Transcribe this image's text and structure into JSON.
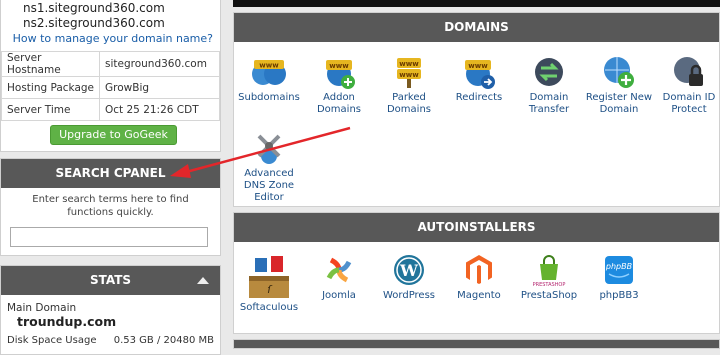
{
  "left": {
    "ns1": "ns1.siteground360.com",
    "ns2": "ns2.siteground360.com",
    "how_link": "How to manage your domain name?",
    "info_rows": [
      {
        "label": "Server Hostname",
        "value": "siteground360.com"
      },
      {
        "label": "Hosting Package",
        "value": "GrowBig"
      },
      {
        "label": "Server Time",
        "value": "Oct 25 21:26 CDT"
      }
    ],
    "upgrade_label": "Upgrade to GoGeek",
    "search": {
      "title": "SEARCH CPANEL",
      "help": "Enter search terms here to find functions quickly.",
      "placeholder": ""
    },
    "stats": {
      "title": "STATS",
      "main_domain_label": "Main Domain",
      "main_domain": "troundup.com",
      "disk_label": "Disk Space Usage",
      "disk_value": "0.53 GB / 20480 MB"
    }
  },
  "domains": {
    "title": "DOMAINS",
    "items": [
      {
        "label": "Subdomains",
        "icon": "subdomains-icon"
      },
      {
        "label": "Addon Domains",
        "icon": "addon-domains-icon"
      },
      {
        "label": "Parked Domains",
        "icon": "parked-domains-icon"
      },
      {
        "label": "Redirects",
        "icon": "redirects-icon"
      },
      {
        "label": "Domain Transfer",
        "icon": "domain-transfer-icon"
      },
      {
        "label": "Register New Domain",
        "icon": "register-domain-icon"
      },
      {
        "label": "Domain ID Protect",
        "icon": "domain-id-protect-icon"
      },
      {
        "label": "Advanced DNS Zone Editor",
        "icon": "dns-zone-editor-icon"
      }
    ]
  },
  "autoinstallers": {
    "title": "AUTOINSTALLERS",
    "items": [
      {
        "label": "Softaculous",
        "icon": "softaculous-icon"
      },
      {
        "label": "Joomla",
        "icon": "joomla-icon"
      },
      {
        "label": "WordPress",
        "icon": "wordpress-icon"
      },
      {
        "label": "Magento",
        "icon": "magento-icon"
      },
      {
        "label": "PrestaShop",
        "icon": "prestashop-icon"
      },
      {
        "label": "phpBB3",
        "icon": "phpbb3-icon"
      }
    ]
  },
  "colors": {
    "header_bg": "#585858",
    "upgrade_green": "#5fb246",
    "link_blue": "#1a5ea8",
    "arrow_red": "#e3262a"
  }
}
